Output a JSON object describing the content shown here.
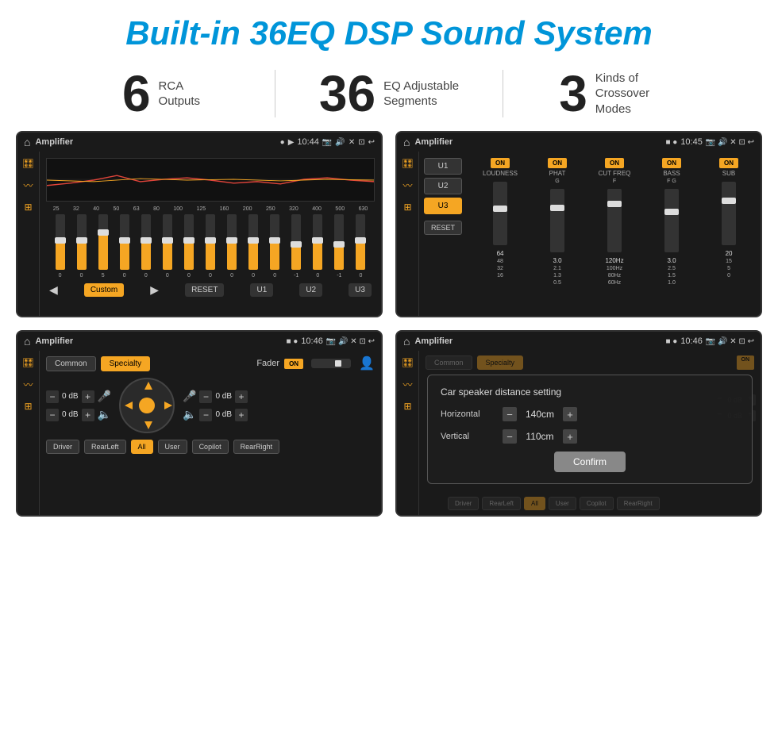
{
  "header": {
    "title": "Built-in 36EQ DSP Sound System"
  },
  "stats": [
    {
      "number": "6",
      "text_line1": "RCA",
      "text_line2": "Outputs"
    },
    {
      "number": "36",
      "text_line1": "EQ Adjustable",
      "text_line2": "Segments"
    },
    {
      "number": "3",
      "text_line1": "Kinds of",
      "text_line2": "Crossover Modes"
    }
  ],
  "screen1": {
    "statusbar": {
      "app": "Amplifier",
      "time": "10:44"
    },
    "eq_bands": [
      "25",
      "32",
      "40",
      "50",
      "63",
      "80",
      "100",
      "125",
      "160",
      "200",
      "250",
      "320",
      "400",
      "500",
      "630"
    ],
    "eq_values": [
      "0",
      "0",
      "5",
      "0",
      "0",
      "0",
      "0",
      "0",
      "0",
      "0",
      "0",
      "-1",
      "0",
      "-1",
      "0"
    ],
    "buttons": [
      "Custom",
      "RESET",
      "U1",
      "U2",
      "U3"
    ]
  },
  "screen2": {
    "statusbar": {
      "app": "Amplifier",
      "time": "10:45"
    },
    "presets": [
      "U1",
      "U2",
      "U3"
    ],
    "channels": [
      {
        "name": "LOUDNESS",
        "on": true
      },
      {
        "name": "PHAT",
        "on": true
      },
      {
        "name": "CUT FREQ",
        "on": true
      },
      {
        "name": "BASS",
        "on": true
      },
      {
        "name": "SUB",
        "on": true
      }
    ],
    "reset_label": "RESET"
  },
  "screen3": {
    "statusbar": {
      "app": "Amplifier",
      "time": "10:46"
    },
    "modes": [
      "Common",
      "Specialty"
    ],
    "fader_label": "Fader",
    "on_label": "ON",
    "vol_rows": [
      {
        "label": "0 dB"
      },
      {
        "label": "0 dB"
      },
      {
        "label": "0 dB"
      },
      {
        "label": "0 dB"
      }
    ],
    "bottom_buttons": [
      "Driver",
      "RearLeft",
      "All",
      "User",
      "Copilot",
      "RearRight"
    ]
  },
  "screen4": {
    "statusbar": {
      "app": "Amplifier",
      "time": "10:46"
    },
    "dialog": {
      "title": "Car speaker distance setting",
      "fields": [
        {
          "label": "Horizontal",
          "value": "140cm"
        },
        {
          "label": "Vertical",
          "value": "110cm"
        }
      ],
      "confirm_label": "Confirm"
    },
    "vol_rows": [
      {
        "label": "0 dB"
      },
      {
        "label": "0 dB"
      }
    ],
    "bottom_buttons": [
      "Driver",
      "RearLeft",
      "All",
      "User",
      "Copilot",
      "RearRight"
    ]
  }
}
